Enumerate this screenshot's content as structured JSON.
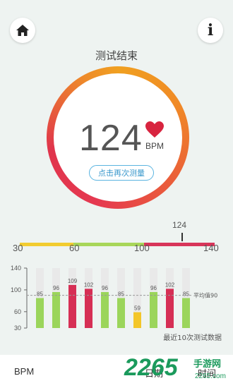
{
  "header": {
    "title": "测试结束",
    "info_label": "i"
  },
  "result": {
    "bpm_value": "124",
    "bpm_unit": "BPM",
    "remeasure_label": "点击再次测量"
  },
  "scale": {
    "min": 30,
    "max": 140,
    "marker_value": 124,
    "marker_label": "124",
    "ticks": [
      "30",
      "60",
      "100",
      "140"
    ],
    "colors": {
      "low": "#f2cc30",
      "normal": "#a8d65a",
      "high": "#d8355a"
    }
  },
  "chart_data": {
    "type": "bar",
    "values": [
      85,
      96,
      109,
      102,
      96,
      85,
      59,
      96,
      102,
      85
    ],
    "ylim": [
      30,
      140
    ],
    "yticks": [
      "140",
      "100",
      "60",
      "30"
    ],
    "average_value": 90,
    "average_label": "平均值90",
    "caption": "最近10次测试数据",
    "colors": {
      "normal": "#9bd55b",
      "high": "#d62f55",
      "low": "#f3c62a",
      "track": "#e9e9e9"
    }
  },
  "table_header": {
    "col_bpm": "BPM",
    "col_date": "日期",
    "col_time": "时间"
  },
  "watermark": {
    "text": "2265",
    "cn": "手游网",
    "url": "2265.com"
  }
}
